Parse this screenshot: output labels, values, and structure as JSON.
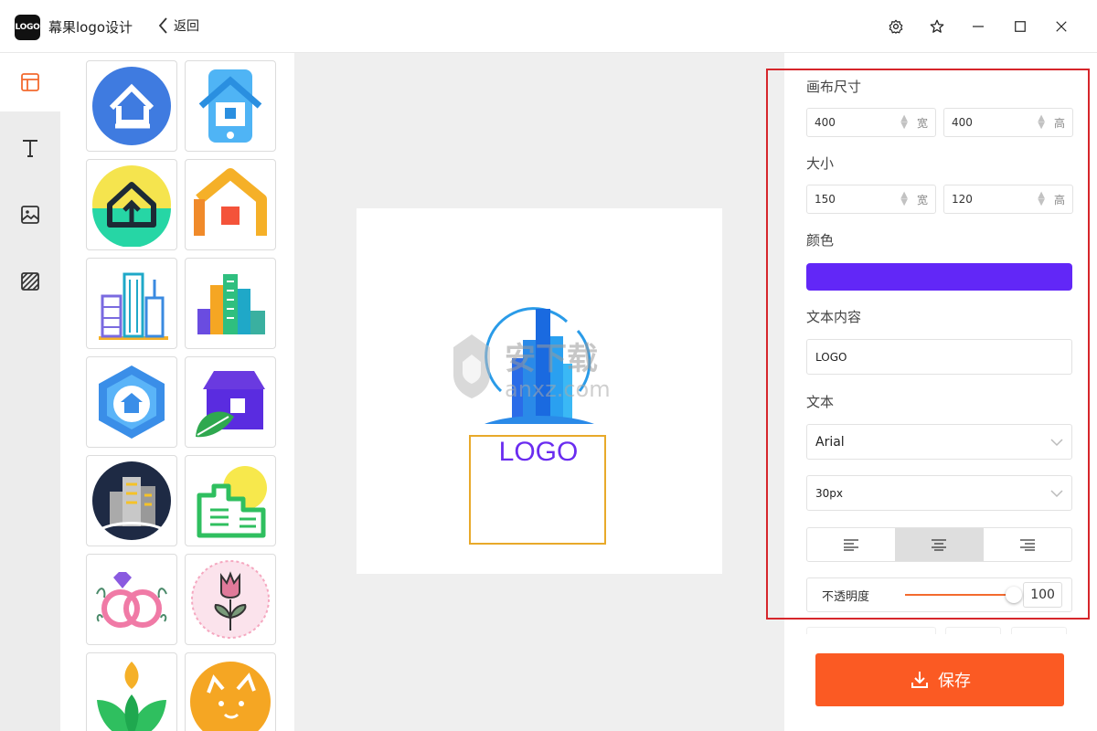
{
  "app": {
    "logo_text": "LOGO",
    "title": "幕果logo设计",
    "back_label": "返回"
  },
  "colors": {
    "accent": "#fb5a23",
    "selected_color": "#6227f7",
    "frame": "#d6262b",
    "logo_text_color": "#6a2cf0"
  },
  "toolbar": {
    "icons": [
      "settings-icon",
      "star-icon",
      "minimize-icon",
      "maximize-icon",
      "close-icon"
    ]
  },
  "tools": [
    "layout-icon",
    "text-icon",
    "image-icon",
    "pattern-icon"
  ],
  "canvas": {
    "logo_text": "LOGO",
    "watermark_text": "安下载",
    "watermark_domain": "anxz.com"
  },
  "panel": {
    "canvas_size": {
      "label": "画布尺寸",
      "width": "400",
      "width_unit": "宽",
      "height": "400",
      "height_unit": "高"
    },
    "size": {
      "label": "大小",
      "width": "150",
      "width_unit": "宽",
      "height": "120",
      "height_unit": "高"
    },
    "color": {
      "label": "颜色",
      "value": "#6227f7"
    },
    "text_content": {
      "label": "文本内容",
      "value": "LOGO"
    },
    "text": {
      "label": "文本",
      "font": "Arial",
      "font_size": "30px"
    },
    "alignment": {
      "options": [
        "left",
        "center",
        "right"
      ],
      "selected": "center"
    },
    "opacity": {
      "label": "不透明度",
      "value": "100",
      "level": 1.0
    }
  },
  "save_label": "保存"
}
